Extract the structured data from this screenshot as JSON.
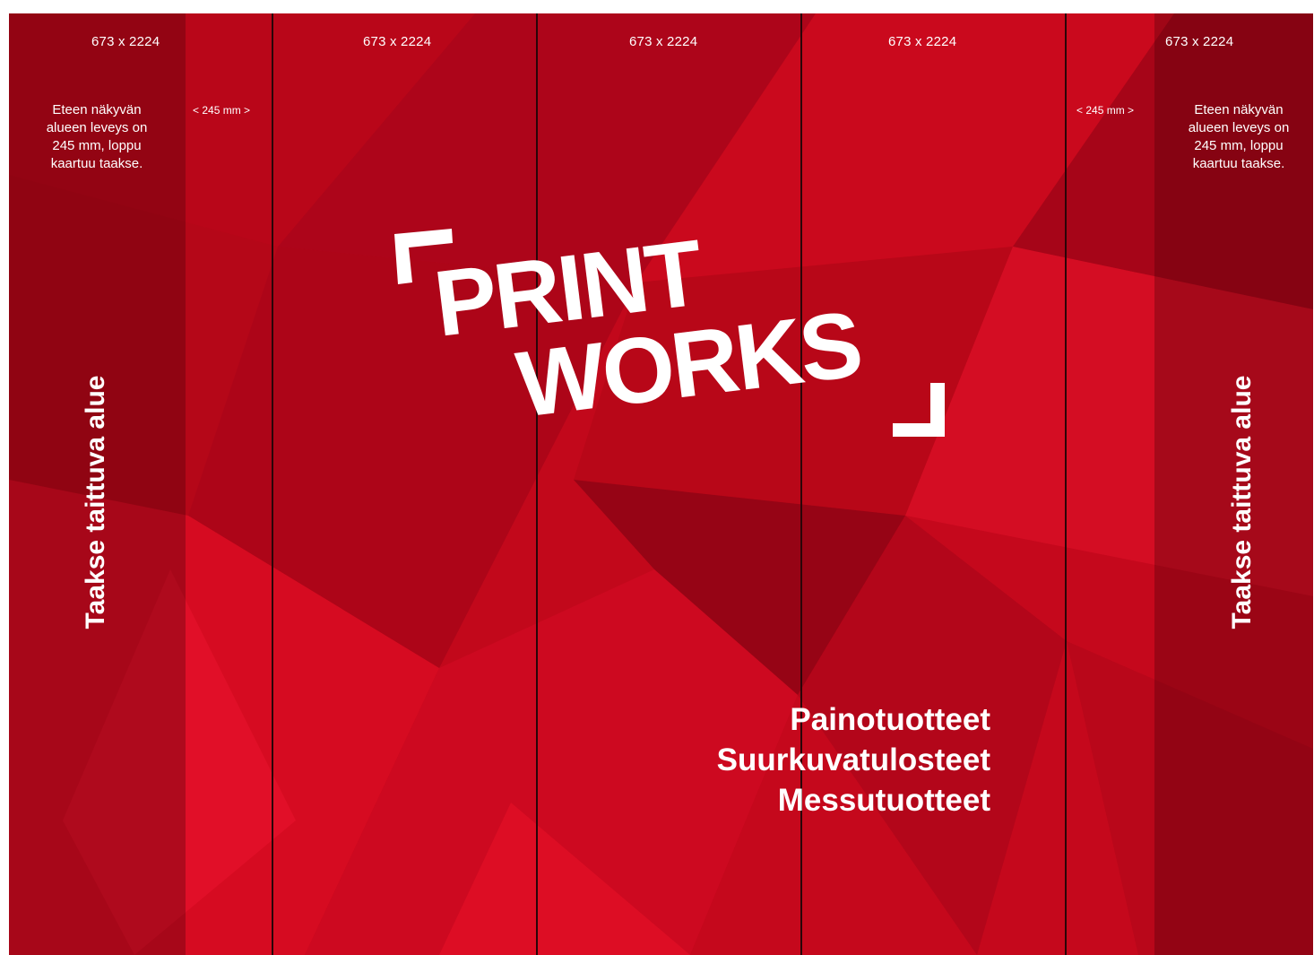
{
  "panels": {
    "dimension_label": "673 x 2224"
  },
  "side_note": {
    "lines": [
      "Eteen näkyvän",
      "alueen leveys on",
      "245 mm, loppu",
      "kaartuu taakse."
    ]
  },
  "width_marker": "< 245 mm >",
  "fold_label": "Taakse taittuva alue",
  "logo": {
    "line1": "PRINT",
    "line2": "WORKS"
  },
  "taglines": [
    "Painotuotteet",
    "Suurkuvatulosteet",
    "Messutuotteet"
  ],
  "colors": {
    "background_red": "#c3081c",
    "text": "#ffffff",
    "divider": "#2a0508"
  }
}
